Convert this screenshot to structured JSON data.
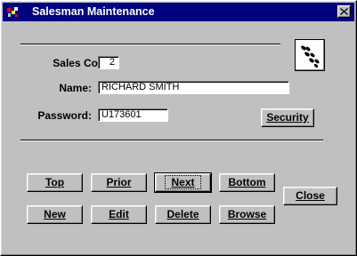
{
  "window": {
    "title": "Salesman Maintenance",
    "close_glyph": "✕"
  },
  "colors": {
    "titlebar": "#000080",
    "face": "#c0c0c0"
  },
  "icons": {
    "app_icon": "app-icon",
    "close": "close-icon",
    "logo": "footprints-logo-icon"
  },
  "form": {
    "sales_code": {
      "label": "Sales Code:",
      "value": "2"
    },
    "name": {
      "label": "Name:",
      "value": "RICHARD SMITH"
    },
    "password": {
      "label": "Password:",
      "value": "U173601"
    }
  },
  "buttons": {
    "security": "Security",
    "top": "Top",
    "prior": "Prior",
    "next": "Next",
    "bottom": "Bottom",
    "new": "New",
    "edit": "Edit",
    "delete": "Delete",
    "browse": "Browse",
    "close": "Close"
  }
}
